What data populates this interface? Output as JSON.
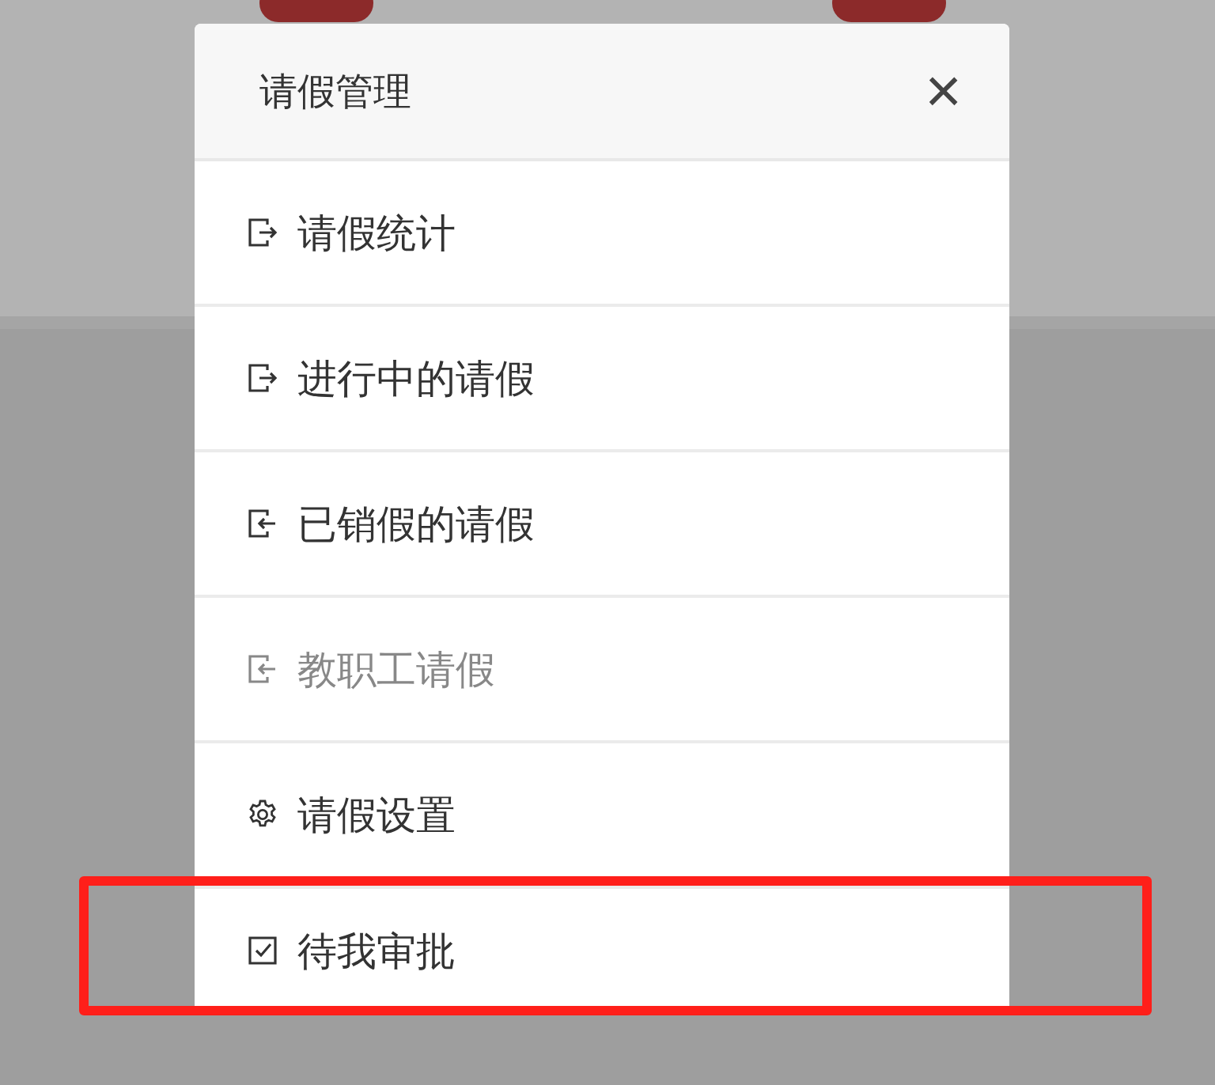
{
  "dialog": {
    "title": "请假管理",
    "close": "×"
  },
  "items": [
    {
      "label": "请假统计",
      "kind": "exit",
      "disabled": false,
      "highlighted": false
    },
    {
      "label": "进行中的请假",
      "kind": "exit",
      "disabled": false,
      "highlighted": false
    },
    {
      "label": "已销假的请假",
      "kind": "enter",
      "disabled": false,
      "highlighted": false
    },
    {
      "label": "教职工请假",
      "kind": "enter",
      "disabled": true,
      "highlighted": false
    },
    {
      "label": "请假设置",
      "kind": "gear",
      "disabled": false,
      "highlighted": false
    },
    {
      "label": "待我审批",
      "kind": "check",
      "disabled": false,
      "highlighted": true
    }
  ]
}
